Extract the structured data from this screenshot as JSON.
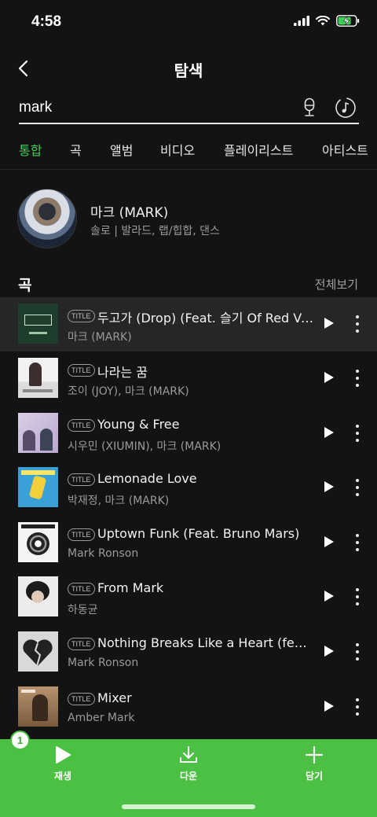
{
  "status_bar": {
    "time": "4:58"
  },
  "header": {
    "title": "탐색"
  },
  "search": {
    "query": "mark"
  },
  "tabs": [
    {
      "label": "통합",
      "active": true
    },
    {
      "label": "곡"
    },
    {
      "label": "앨범"
    },
    {
      "label": "비디오"
    },
    {
      "label": "플레이리스트"
    },
    {
      "label": "아티스트"
    }
  ],
  "artist": {
    "name": "마크 (MARK)",
    "genre": "솔로 | 발라드, 랩/힙합, 댄스"
  },
  "songs_section": {
    "title": "곡",
    "see_all": "전체보기"
  },
  "songs": [
    {
      "badge": "TITLE",
      "title": "두고가 (Drop) (Feat. 슬기 Of Red Ve...",
      "artist": "마크 (MARK)"
    },
    {
      "badge": "TITLE",
      "title": "나라는 꿈",
      "artist": "조이 (JOY), 마크 (MARK)"
    },
    {
      "badge": "TITLE",
      "title": "Young & Free",
      "artist": "시우민 (XIUMIN), 마크 (MARK)"
    },
    {
      "badge": "TITLE",
      "title": "Lemonade Love",
      "artist": "박재정, 마크 (MARK)"
    },
    {
      "badge": "TITLE",
      "title": "Uptown Funk (Feat. Bruno Mars)",
      "artist": "Mark Ronson"
    },
    {
      "badge": "TITLE",
      "title": "From Mark",
      "artist": "하동균"
    },
    {
      "badge": "TITLE",
      "title": "Nothing Breaks Like a Heart (feat. ...",
      "artist": "Mark Ronson"
    },
    {
      "badge": "TITLE",
      "title": "Mixer",
      "artist": "Amber Mark"
    }
  ],
  "bottom_bar": {
    "selected_count": "1",
    "play_label": "재생",
    "download_label": "다운",
    "add_label": "담기"
  },
  "colors": {
    "accent": "#3fcf55",
    "bottom_bar": "#4bc043",
    "background": "#131313"
  },
  "icons": [
    "back-icon",
    "mic-icon",
    "music-search-icon",
    "play-icon",
    "more-icon",
    "download-icon",
    "plus-icon"
  ]
}
